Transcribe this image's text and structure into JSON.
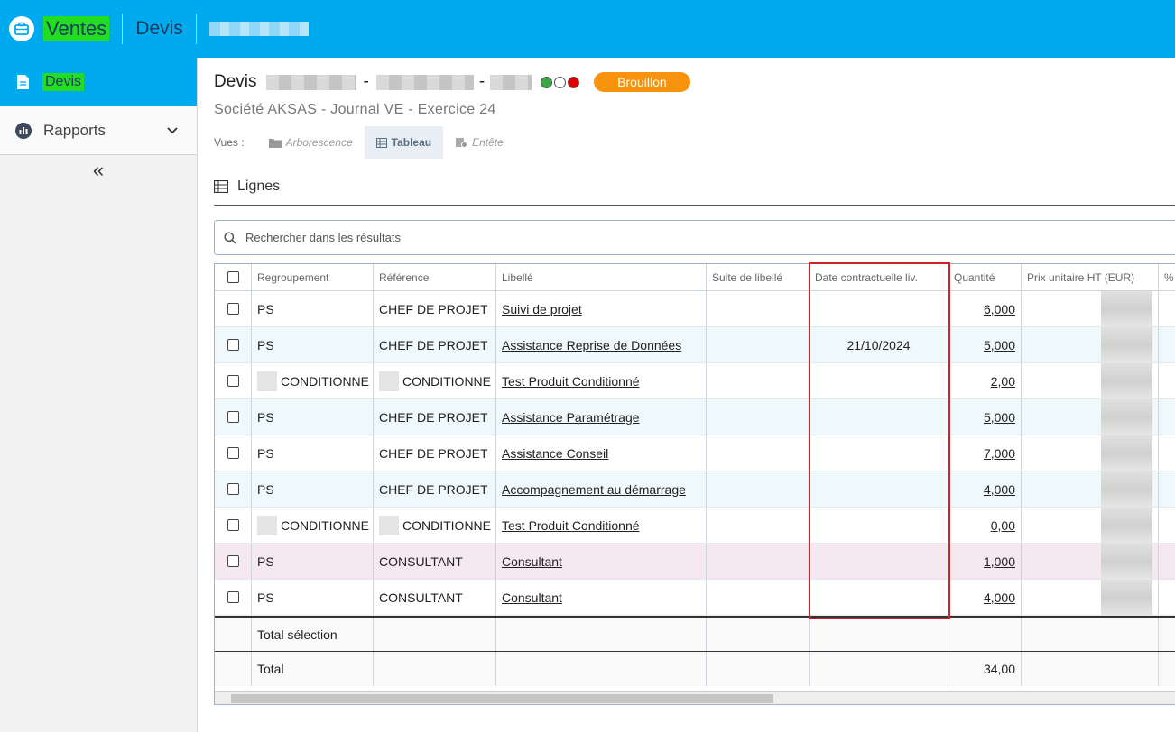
{
  "topbar": {
    "app_name": "Ventes",
    "module": "Devis"
  },
  "sidebar": {
    "items": [
      {
        "label": "Devis",
        "active": true
      },
      {
        "label": "Rapports",
        "active": false
      }
    ],
    "collapse_glyph": "«"
  },
  "header": {
    "title_prefix": "Devis",
    "sep1": "-",
    "sep2": "-",
    "status_badge": "Brouillon",
    "status_color": "#f7930e",
    "status_dots": [
      "#3aa843",
      "#ffffff",
      "#e00000"
    ],
    "subtitle": "Société AKSAS  -  Journal VE  -  Exercice 24"
  },
  "views": {
    "label": "Vues :",
    "items": [
      {
        "label": "Arborescence",
        "icon": "folder-icon",
        "active": false
      },
      {
        "label": "Tableau",
        "icon": "table-icon",
        "active": true
      },
      {
        "label": "Entête",
        "icon": "header-doc-icon",
        "active": false
      }
    ]
  },
  "section": {
    "title": "Lignes"
  },
  "search": {
    "placeholder": "Rechercher dans les résultats"
  },
  "table": {
    "headers": [
      "Regroupement",
      "Référence",
      "Libellé",
      "Suite de libellé",
      "Date contractuelle liv.",
      "Quantité",
      "Prix unitaire HT (EUR)",
      "%"
    ],
    "rows": [
      {
        "group": "PS",
        "ref": "CHEF DE PROJET",
        "label": "Suivi de projet",
        "suite": "",
        "date": "",
        "qty": "6,000",
        "masked": false
      },
      {
        "group": "PS",
        "ref": "CHEF DE PROJET",
        "label": "Assistance Reprise de Données",
        "suite": "",
        "date": "21/10/2024",
        "qty": "5,000",
        "masked": false
      },
      {
        "group": "CONDITIONNE",
        "ref": "CONDITIONNE",
        "label": "Test Produit Conditionné",
        "suite": "",
        "date": "",
        "qty": "2,00",
        "masked": true
      },
      {
        "group": "PS",
        "ref": "CHEF DE PROJET",
        "label": "Assistance Paramétrage ",
        "suite": "",
        "date": "",
        "qty": "5,000",
        "masked": false
      },
      {
        "group": "PS",
        "ref": "CHEF DE PROJET",
        "label": "Assistance Conseil ",
        "suite": "",
        "date": "",
        "qty": "7,000",
        "masked": false
      },
      {
        "group": "PS",
        "ref": "CHEF DE PROJET",
        "label": "Accompagnement au démarrage",
        "suite": "",
        "date": "",
        "qty": "4,000",
        "masked": false
      },
      {
        "group": "CONDITIONNE",
        "ref": "CONDITIONNE",
        "label": "Test Produit Conditionné",
        "suite": "",
        "date": "",
        "qty": "0,00",
        "masked": true
      },
      {
        "group": "PS",
        "ref": "CONSULTANT",
        "label": "Consultant",
        "suite": "",
        "date": "",
        "qty": "1,000",
        "masked": false
      },
      {
        "group": "PS",
        "ref": "CONSULTANT",
        "label": "Consultant",
        "suite": "",
        "date": "",
        "qty": "4,000",
        "masked": false
      }
    ],
    "total_selection_label": "Total sélection",
    "total_label": "Total",
    "total_qty": "34,00"
  }
}
